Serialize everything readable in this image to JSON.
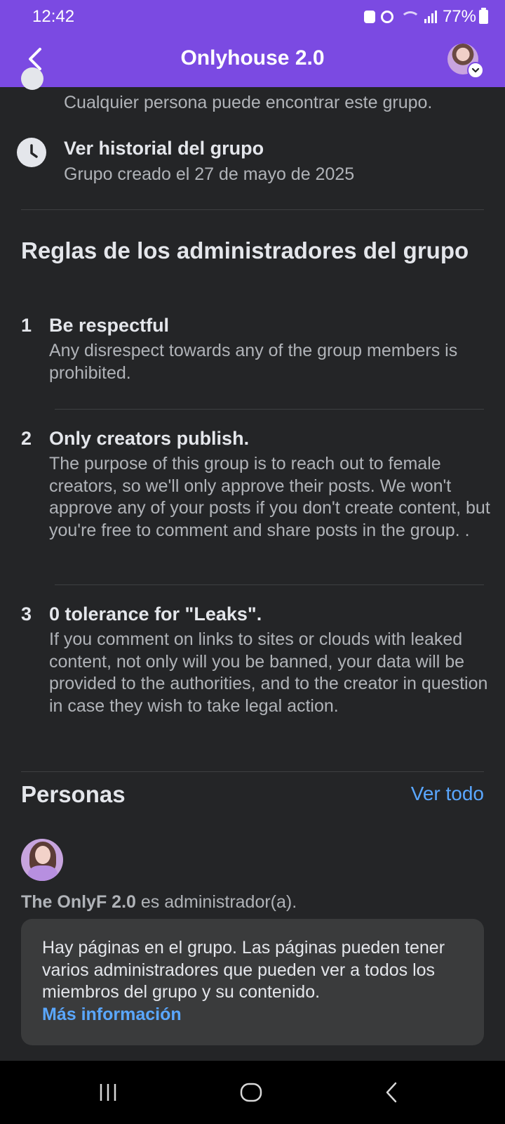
{
  "status_bar": {
    "time": "12:42",
    "battery": "77%"
  },
  "header": {
    "title": "Onlyhouse 2.0"
  },
  "about": {
    "privacy_subtitle": "Cualquier persona puede encontrar este grupo.",
    "history_title": "Ver historial del grupo",
    "history_subtitle": "Grupo creado el 27 de mayo de 2025"
  },
  "rules": {
    "heading": "Reglas de los administradores del grupo",
    "items": [
      {
        "number": "1",
        "title": "Be respectful",
        "description": "Any disrespect towards any of the group members is prohibited."
      },
      {
        "number": "2",
        "title": "Only creators publish.",
        "description": "The purpose of this group is to reach out to female creators, so we'll only approve their posts. We won't approve any of your posts if you don't create content, but you're free to comment and share posts in the group. ."
      },
      {
        "number": "3",
        "title": "0 tolerance for \"Leaks\".",
        "description": "If you comment on links to sites or clouds with leaked content, not only will you be banned, your data will be provided to the authorities, and to the creator in question in case they wish to take legal action."
      }
    ]
  },
  "people": {
    "heading": "Personas",
    "see_all": "Ver todo",
    "admin_name": "The OnlyF 2.0",
    "admin_suffix": " es administrador(a)."
  },
  "info_card": {
    "text": "Hay páginas en el grupo. Las páginas pueden tener varios administradores que pueden ver a todos los miembros del grupo y su contenido.",
    "link": "Más información"
  },
  "colors": {
    "header_bg": "#7b4ae2",
    "page_bg": "#242527",
    "link": "#5aa7ff"
  }
}
